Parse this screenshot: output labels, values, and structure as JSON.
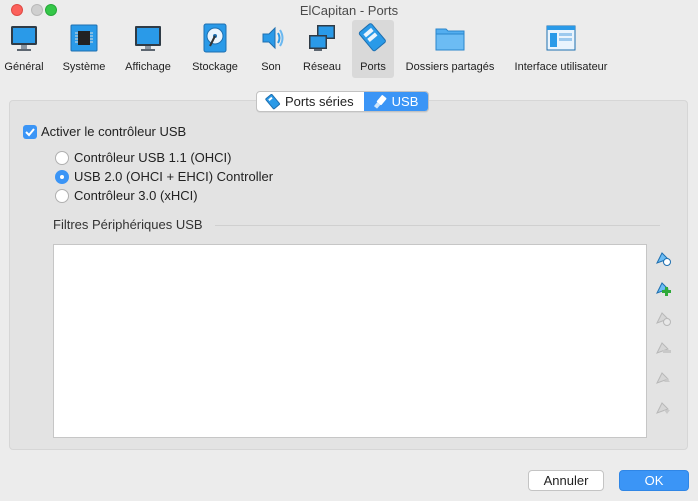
{
  "window": {
    "title": "ElCapitan - Ports"
  },
  "toolbar": {
    "items": [
      {
        "label": "Général"
      },
      {
        "label": "Système"
      },
      {
        "label": "Affichage"
      },
      {
        "label": "Stockage"
      },
      {
        "label": "Son"
      },
      {
        "label": "Réseau"
      },
      {
        "label": "Ports"
      },
      {
        "label": "Dossiers partagés"
      },
      {
        "label": "Interface utilisateur"
      }
    ],
    "selected": "Ports"
  },
  "tabs": [
    {
      "label": "Ports séries",
      "icon": "serial-port-icon"
    },
    {
      "label": "USB",
      "icon": "usb-icon"
    }
  ],
  "usb": {
    "enable_label": "Activer le contrôleur USB",
    "enabled": true,
    "controllers": [
      {
        "label": "Contrôleur USB 1.1 (OHCI)",
        "selected": false
      },
      {
        "label": "USB 2.0 (OHCI + EHCI) Controller",
        "selected": true
      },
      {
        "label": "Contrôleur 3.0 (xHCI)",
        "selected": false
      }
    ],
    "filters_label": "Filtres Périphériques USB",
    "filters": []
  },
  "buttons": {
    "cancel": "Annuler",
    "ok": "OK"
  },
  "colors": {
    "accent": "#3b95f6",
    "close": "#fc605b",
    "maximize": "#34c748"
  }
}
